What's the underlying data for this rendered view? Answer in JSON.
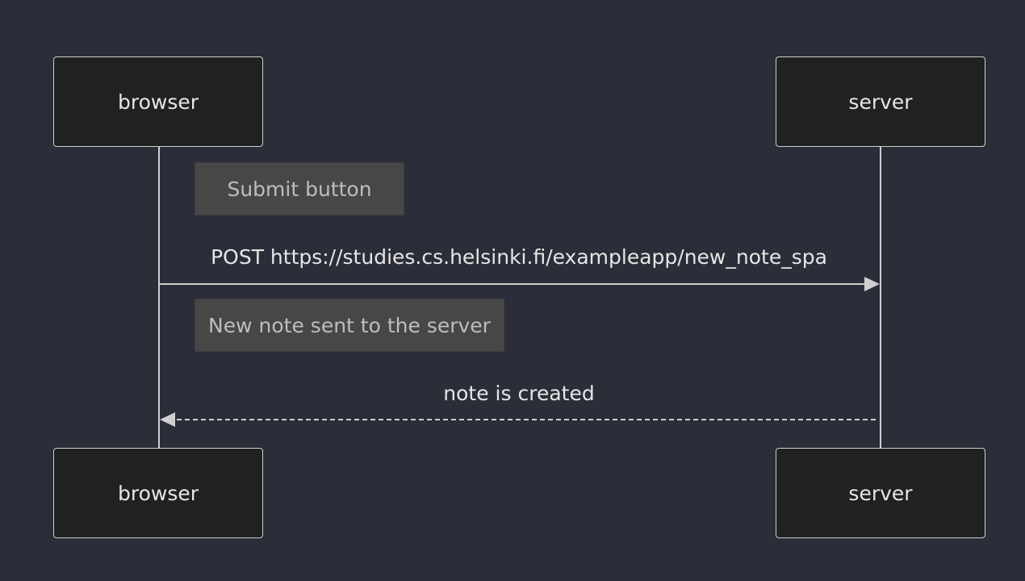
{
  "participants": {
    "left": "browser",
    "right": "server"
  },
  "notes": [
    "Submit button",
    "New note sent to the server"
  ],
  "messages": [
    {
      "label": "POST https://studies.cs.helsinki.fi/exampleapp/new_note_spa",
      "from": "browser",
      "to": "server",
      "style": "solid"
    },
    {
      "label": "note is created",
      "from": "server",
      "to": "browser",
      "style": "dashed"
    }
  ],
  "colors": {
    "background": "#2b2e38",
    "actor_fill": "#202121",
    "line": "#cfcfcf",
    "note_fill": "#474747",
    "note_text": "#bdbdbd",
    "text": "#e6e6e6"
  }
}
